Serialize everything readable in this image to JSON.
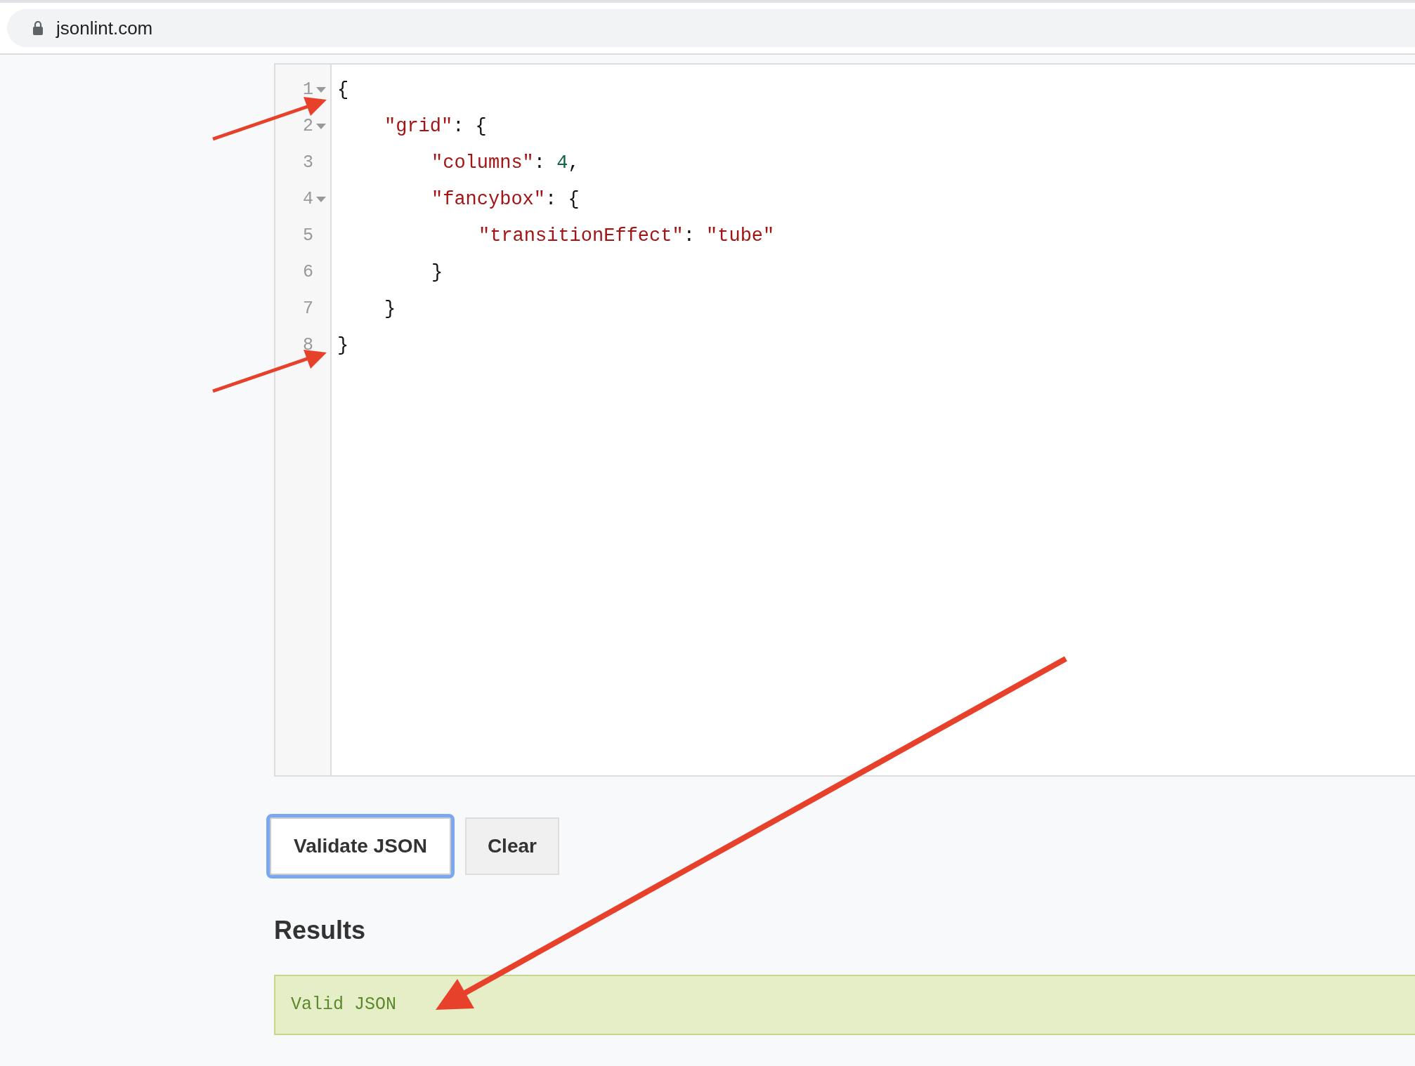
{
  "browser": {
    "url": "jsonlint.com"
  },
  "editor": {
    "lines": [
      {
        "number": "1",
        "foldable": true,
        "tokens": [
          {
            "kind": "punct",
            "text": "{"
          }
        ],
        "children": [
          {
            "number": "2",
            "foldable": true,
            "tokens": [
              {
                "kind": "key",
                "text": "\"grid\""
              },
              {
                "kind": "punct",
                "text": ": {"
              }
            ],
            "children": [
              {
                "number": "3",
                "foldable": false,
                "tokens": [
                  {
                    "kind": "key",
                    "text": "\"columns\""
                  },
                  {
                    "kind": "punct",
                    "text": ": "
                  },
                  {
                    "kind": "number",
                    "text": "4"
                  },
                  {
                    "kind": "punct",
                    "text": ","
                  }
                ]
              },
              {
                "number": "4",
                "foldable": true,
                "tokens": [
                  {
                    "kind": "key",
                    "text": "\"fancybox\""
                  },
                  {
                    "kind": "punct",
                    "text": ": {"
                  }
                ],
                "children": [
                  {
                    "number": "5",
                    "foldable": false,
                    "tokens": [
                      {
                        "kind": "key",
                        "text": "\"transitionEffect\""
                      },
                      {
                        "kind": "punct",
                        "text": ": "
                      },
                      {
                        "kind": "string",
                        "text": "\"tube\""
                      }
                    ]
                  }
                ]
              },
              {
                "number": "6",
                "foldable": false,
                "tokens": [
                  {
                    "kind": "punct",
                    "text": "}"
                  }
                ]
              }
            ]
          },
          {
            "number": "7",
            "foldable": false,
            "tokens": [
              {
                "kind": "punct",
                "text": "}"
              }
            ]
          }
        ]
      },
      {
        "number": "8",
        "foldable": false,
        "tokens": [
          {
            "kind": "punct",
            "text": "}"
          }
        ]
      }
    ]
  },
  "buttons": [
    {
      "label": "Validate JSON",
      "kind": "primary",
      "focused": true
    },
    {
      "label": "Clear",
      "kind": "secondary",
      "focused": false
    }
  ],
  "results": {
    "heading": "Results",
    "message": "Valid JSON"
  }
}
